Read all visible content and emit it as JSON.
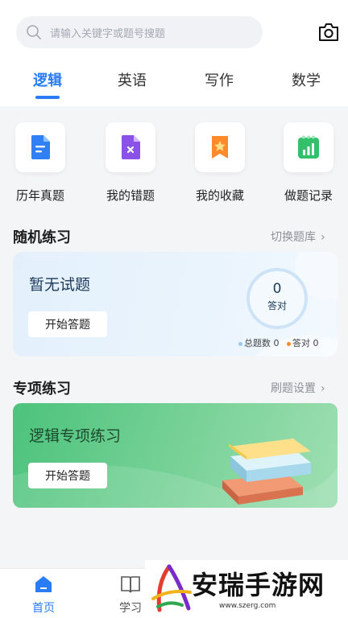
{
  "search": {
    "placeholder": "请输入关键字或题号搜题",
    "icon": "search-icon"
  },
  "camera_icon": "camera-icon",
  "tabs": [
    {
      "label": "逻辑",
      "active": true
    },
    {
      "label": "英语",
      "active": false
    },
    {
      "label": "写作",
      "active": false
    },
    {
      "label": "数学",
      "active": false
    }
  ],
  "quick_actions": [
    {
      "label": "历年真题",
      "icon": "document-icon",
      "color": "#2f7ff5"
    },
    {
      "label": "我的错题",
      "icon": "wrong-file-icon",
      "color": "#8a52e6"
    },
    {
      "label": "我的收藏",
      "icon": "bookmark-star-icon",
      "color": "#ff8a2a"
    },
    {
      "label": "做题记录",
      "icon": "record-chart-icon",
      "color": "#33c06a"
    }
  ],
  "random_practice": {
    "title": "随机练习",
    "link": "切换题库",
    "card_title": "暂无试题",
    "button": "开始答题",
    "answered_count": "0",
    "answered_label": "答对",
    "total_label": "总题数 0",
    "correct_label": "答对 0"
  },
  "topic_practice": {
    "title": "专项练习",
    "link": "刷题设置",
    "card_title": "逻辑专项练习",
    "button": "开始答题"
  },
  "bottom_nav": [
    {
      "label": "首页",
      "icon": "home-icon",
      "active": true
    },
    {
      "label": "学习",
      "icon": "book-icon",
      "active": false
    }
  ],
  "watermark": {
    "text": "安瑞手游网",
    "url": "www.szerg.com"
  },
  "colors": {
    "accent": "#2a7bf6",
    "green_card": "#4cc37c",
    "blue_card": "#e3f0fb"
  }
}
